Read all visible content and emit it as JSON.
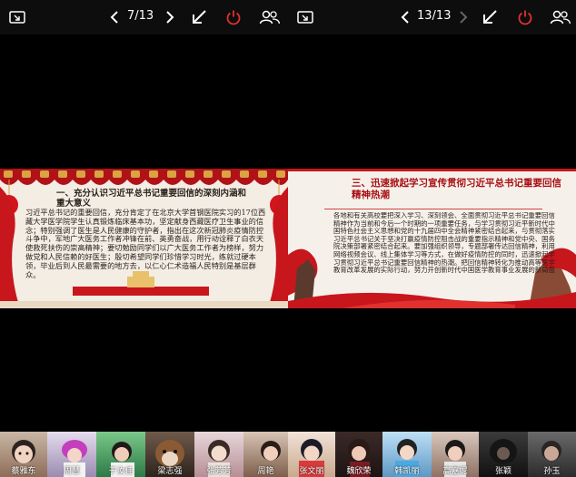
{
  "left": {
    "page_indicator": "7/13",
    "slide": {
      "title": "一、充分认识习近平总书记重要回信的深刻内涵和重大意义",
      "body": "习近平总书记的重要回信，充分肯定了在北京大学首钢医院实习的17位西藏大学医学院学生认真锻炼临床基本功，坚定献身西藏医疗卫生事业的信念；特别强调了医生是人民健康的守护者，指出在这次新冠肺炎疫情防控斗争中，军地广大医务工作者冲锋在前、英勇奋战，用行动诠释了白衣天使救死扶伤的崇高精神；要切勉励同学们以广大医务工作者为榜样，努力做党和人民信赖的好医生；殷切希望同学们珍惜学习时光，练就过硬本领，毕业后到人民最需要的地方去，以仁心仁术造福人民特别是基层群众。"
    },
    "participants": [
      {
        "name": "蔡雅东"
      },
      {
        "name": "周慧"
      },
      {
        "name": "于汝佳"
      },
      {
        "name": "梁志强"
      },
      {
        "name": "张芳芳"
      },
      {
        "name": "周艳"
      }
    ]
  },
  "right": {
    "page_indicator": "13/13",
    "slide": {
      "title": "三、迅速掀起学习宣传贯彻习近平总书记重要回信精神热潮",
      "body": "各地和有关高校要把深入学习、深刻领会、全面贯彻习近平总书记重要回信精神作为当前和今后一个时期的一项重要任务，与学习贯彻习近平新时代中国特色社会主义思想和党的十九届四中全会精神紧密结合起来，与贯彻落实习近平总书记关于坚决打赢疫情防控阻击战的重要指示精神和党中央、国务院决策部署紧密结合起来。要加强组织领导，专题部署传达回信精神，利用网络视频会议、线上集体学习等方式，在做好疫情防控的同时，迅速掀起学习贯彻习近平总书记重要回信精神的热潮。把回信精神转化为推动高等医学教育改革发展的实际行动，努力开创新时代中国医学教育事业发展的新局面"
    },
    "participants": [
      {
        "name": "张文丽"
      },
      {
        "name": "魏欣荣"
      },
      {
        "name": "韩凯丽"
      },
      {
        "name": "高嘉妮"
      },
      {
        "name": "张颖"
      },
      {
        "name": "孙玉"
      }
    ]
  },
  "colors": {
    "exit_red": "#e0312f",
    "slide_red": "#c8161d",
    "gold": "#d9a441"
  },
  "icons": [
    "screen-share-icon",
    "prev-page-icon",
    "next-page-icon",
    "collapse-arrow-icon",
    "power-exit-icon",
    "participants-icon"
  ]
}
